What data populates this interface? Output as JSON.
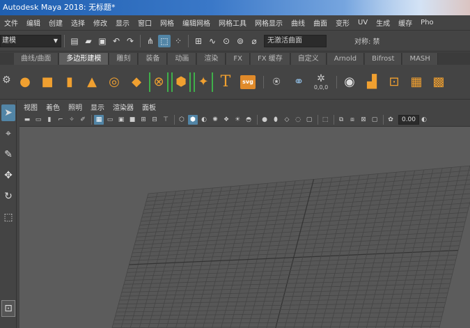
{
  "window": {
    "title": "Autodesk Maya 2018: 无标题*"
  },
  "menubar": [
    "文件",
    "编辑",
    "创建",
    "选择",
    "修改",
    "显示",
    "窗口",
    "网格",
    "编辑网格",
    "网格工具",
    "网格显示",
    "曲线",
    "曲面",
    "变形",
    "UV",
    "生成",
    "缓存",
    "Pho"
  ],
  "statusline": {
    "mode": "建模",
    "live_surface": "无激活曲面",
    "symmetry": "对称: 禁"
  },
  "shelf": {
    "tabs": [
      "曲线/曲面",
      "多边形建模",
      "雕刻",
      "装备",
      "动画",
      "渲染",
      "FX",
      "FX 缓存",
      "自定义",
      "Arnold",
      "Bifrost",
      "MASH"
    ],
    "active_tab": "多边形建模",
    "text_tool_glyph": "T",
    "svg_label": "svg",
    "uv_label": "0,0,0"
  },
  "panel": {
    "menu": [
      "视图",
      "着色",
      "照明",
      "显示",
      "渲染器",
      "面板"
    ],
    "near_clip": "0.00"
  },
  "colors": {
    "accent": "#5285a6",
    "shelf_icon": "#f0a030",
    "viewport": "#5c5c5c",
    "grid": "#454545"
  },
  "icons": [
    "new-scene-icon",
    "open-scene-icon",
    "save-scene-icon",
    "undo-icon",
    "redo-icon",
    "select-tool-icon",
    "lasso-tool-icon",
    "move-tool-icon",
    "rotate-tool-icon",
    "scale-tool-icon",
    "sphere-icon",
    "cube-icon",
    "cylinder-icon",
    "cone-icon",
    "torus-icon",
    "plane-icon",
    "disc-icon",
    "platonic-icon",
    "type-icon",
    "svg-icon"
  ]
}
